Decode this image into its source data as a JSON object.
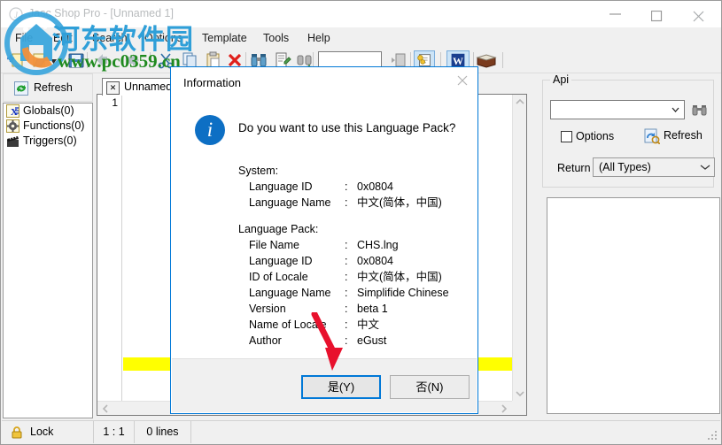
{
  "window": {
    "title": "Jasc Shop Pro - [Unnamed 1]",
    "app_icon": "app-jasc-icon",
    "minimize_label": "Minimize",
    "maximize_label": "Maximize",
    "close_label": "Close"
  },
  "watermark": {
    "logo": "watermark-logo-icon",
    "site_cn": "河东软件园",
    "site_url": "www.pc0359.cn",
    "color_cn": "#2f9fd8",
    "color_url": "#1f8a1f"
  },
  "menubar": {
    "items": [
      {
        "label": "File"
      },
      {
        "label": "Edit"
      },
      {
        "label": "Search"
      },
      {
        "label": "Options"
      },
      {
        "label": "Template"
      },
      {
        "label": "Tools"
      },
      {
        "label": "Help"
      }
    ]
  },
  "toolbar": {
    "buttons": [
      {
        "name": "new-file-button",
        "icon": "new-file-icon"
      },
      {
        "name": "open-file-button",
        "icon": "open-folder-icon"
      },
      {
        "name": "open-file-dropdown",
        "icon": "chevron-down-icon"
      },
      {
        "name": "save-button",
        "icon": "floppy-save-icon"
      },
      {
        "name": "undo-button",
        "icon": "arrow-left-icon"
      },
      {
        "name": "redo-button",
        "icon": "arrow-right-icon"
      },
      {
        "name": "cut-button",
        "icon": "scissors-icon"
      },
      {
        "name": "copy-button",
        "icon": "copy-pages-icon"
      },
      {
        "name": "paste-button",
        "icon": "clipboard-paste-icon"
      },
      {
        "name": "delete-button",
        "icon": "red-x-icon"
      },
      {
        "name": "find-button",
        "icon": "binoculars-icon"
      },
      {
        "name": "find-next-button",
        "icon": "binoculars-icon"
      },
      {
        "name": "replace-button",
        "icon": "document-edit-icon"
      },
      {
        "name": "find-in-files-button",
        "icon": "binoculars-plus-icon"
      },
      {
        "name": "run-button",
        "icon": "run-page-icon"
      },
      {
        "name": "properties-button",
        "icon": "yellow-note-icon"
      },
      {
        "name": "word-button",
        "icon": "w-letter-icon"
      },
      {
        "name": "help-book-button",
        "icon": "open-book-icon"
      }
    ],
    "search_input_value": "",
    "search_input_placeholder": ""
  },
  "left_panel": {
    "refresh_label": "Refresh",
    "refresh_icon": "refresh-arrows-icon",
    "tree_items": [
      {
        "label": "Globals(0)",
        "icon": "variable-x-icon"
      },
      {
        "label": "Functions(0)",
        "icon": "gear-function-icon"
      },
      {
        "label": "Triggers(0)",
        "icon": "clapper-trigger-icon"
      }
    ]
  },
  "editor": {
    "tab_label": "Unnamed 1",
    "tab_close_icon": "close-x-icon",
    "line_numbers": [
      "1"
    ],
    "content": "",
    "highlight_color": "#ffff00",
    "scroll_up_icon": "chevron-up-icon",
    "scroll_down_icon": "chevron-down-icon",
    "scroll_left_icon": "chevron-left-icon",
    "scroll_right_icon": "chevron-right-icon"
  },
  "right_panel": {
    "group_label": "Api",
    "api_combo_value": "",
    "api_combo_arrow": "chevron-down-icon",
    "browse_icon": "binoculars-icon",
    "options_label": "Options",
    "options_checked": false,
    "refresh_label": "Refresh",
    "refresh_icon": "refresh-document-icon",
    "return_label": "Return",
    "return_value": "(All Types)",
    "return_arrow": "chevron-down-icon",
    "list_items": []
  },
  "statusbar": {
    "lock_label": "Lock",
    "lock_icon": "padlock-icon",
    "position": "1 : 1",
    "lines": "0 lines",
    "resize_grip_icon": "resize-grip-icon"
  },
  "dialog": {
    "title": "Information",
    "close_icon": "close-x-icon",
    "icon": "info-circle-icon",
    "icon_glyph": "i",
    "question": "Do you want to use this Language Pack?",
    "system_heading": "System:",
    "system_rows": [
      {
        "key": "Language ID",
        "sep": ":",
        "value": "0x0804"
      },
      {
        "key": "Language Name",
        "sep": ":",
        "value": "中文(简体，中国)"
      }
    ],
    "pack_heading": "Language Pack:",
    "pack_rows": [
      {
        "key": "File Name",
        "sep": ":",
        "value": "CHS.lng"
      },
      {
        "key": "Language ID",
        "sep": ":",
        "value": "0x0804"
      },
      {
        "key": "ID of Locale",
        "sep": ":",
        "value": "中文(简体，中国)"
      },
      {
        "key": "Language Name",
        "sep": ":",
        "value": "Simplifide Chinese"
      },
      {
        "key": "Version",
        "sep": ":",
        "value": "beta 1"
      },
      {
        "key": "Name of Locale",
        "sep": ":",
        "value": "中文"
      },
      {
        "key": "Author",
        "sep": ":",
        "value": "eGust"
      }
    ],
    "yes_label": "是(Y)",
    "no_label": "否(N)",
    "accent_color": "#0078d7"
  },
  "annotation": {
    "arrow_color": "#e8112d",
    "arrow_points_to": "是(Y)"
  }
}
